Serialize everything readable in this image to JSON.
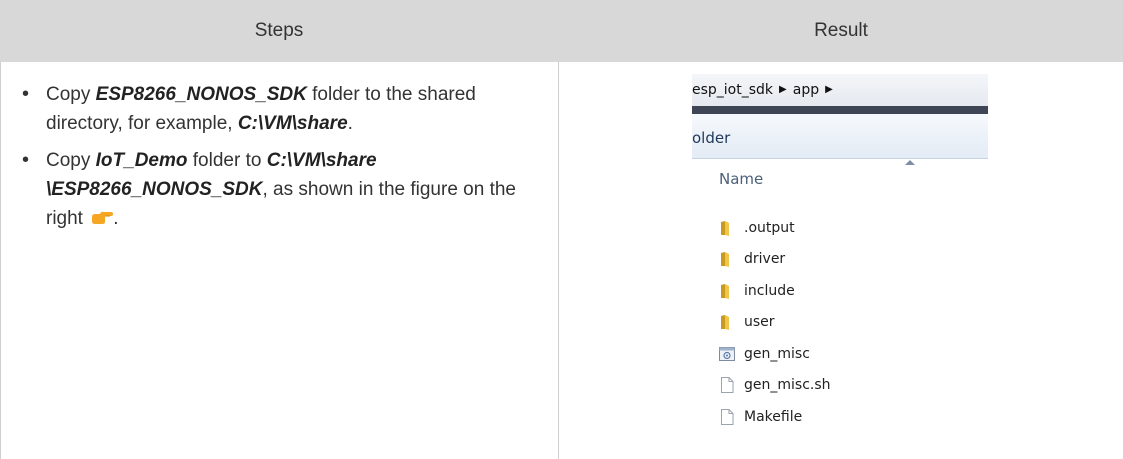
{
  "table": {
    "headers": {
      "steps": "Steps",
      "result": "Result"
    },
    "steps": [
      {
        "parts": [
          {
            "text": "Copy ",
            "bold": false
          },
          {
            "text": "ESP8266_NONOS_SDK",
            "bold": true
          },
          {
            "text": " folder to the shared directory, for example, ",
            "bold": false
          },
          {
            "text": "C:\\VM\\share",
            "bold": true
          },
          {
            "text": ".",
            "bold": false
          }
        ]
      },
      {
        "parts": [
          {
            "text": "Copy ",
            "bold": false
          },
          {
            "text": "IoT_Demo",
            "bold": true
          },
          {
            "text": " folder to ",
            "bold": false
          },
          {
            "text": "C:\\VM\\share \\ESP8266_NONOS_SDK",
            "bold": true
          },
          {
            "text": ", as shown in the figure on the right ",
            "bold": false
          }
        ],
        "trailing_icon": "pointing-hand-icon",
        "trailing_text": "."
      }
    ]
  },
  "explorer": {
    "breadcrumb": [
      "esp_iot_sdk",
      "app"
    ],
    "toolbar_label": "older",
    "column_header": "Name",
    "items": [
      {
        "name": ".output",
        "icon": "folder-icon"
      },
      {
        "name": "driver",
        "icon": "folder-icon"
      },
      {
        "name": "include",
        "icon": "folder-icon"
      },
      {
        "name": "user",
        "icon": "folder-icon"
      },
      {
        "name": "gen_misc",
        "icon": "batch-file-icon"
      },
      {
        "name": "gen_misc.sh",
        "icon": "file-icon"
      },
      {
        "name": "Makefile",
        "icon": "file-icon"
      }
    ]
  },
  "colors": {
    "header_bg": "#d8d8d8",
    "hand_icon": "#f5a623",
    "folder": "#e8b830"
  }
}
